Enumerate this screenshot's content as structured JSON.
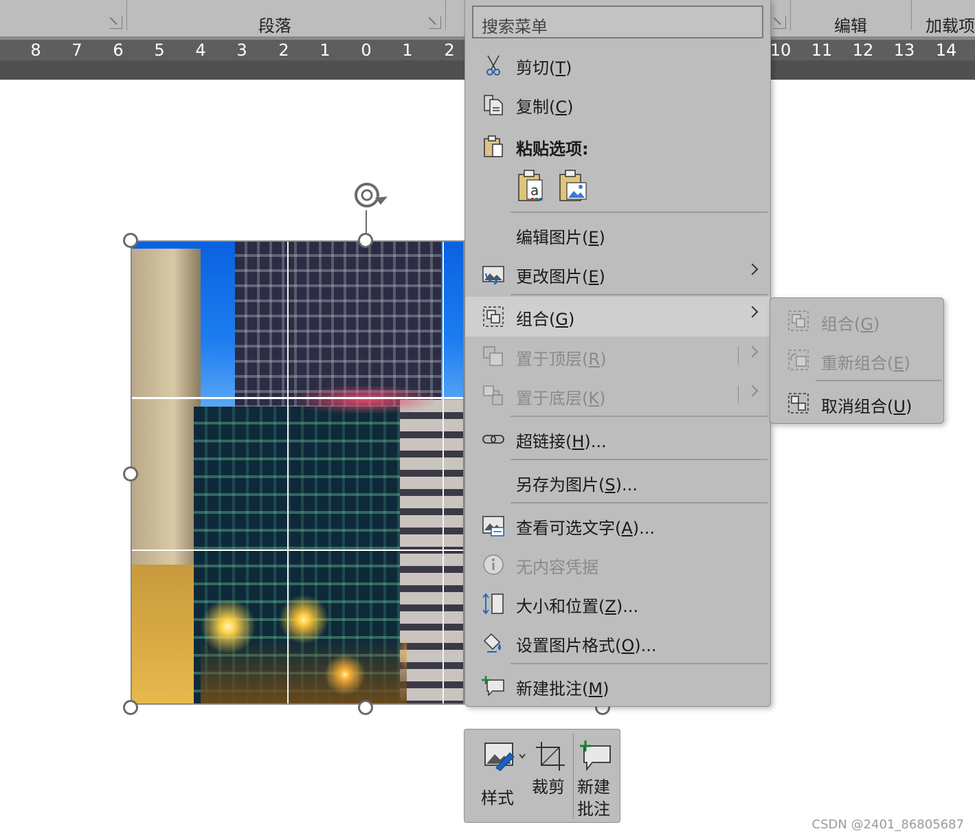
{
  "ribbon": {
    "groups": [
      "段落",
      "编辑",
      "加载项"
    ]
  },
  "ruler": {
    "left_numbers": [
      "8",
      "7",
      "6",
      "5",
      "4",
      "3",
      "2",
      "1",
      "0",
      "1",
      "2"
    ],
    "right_numbers": [
      "10",
      "11",
      "12",
      "13",
      "14"
    ]
  },
  "context_menu": {
    "search_placeholder": "搜索菜单",
    "items": {
      "cut": {
        "label": "剪切(",
        "key": "T",
        "tail": ")",
        "icon": "scissors-icon"
      },
      "copy": {
        "label": "复制(",
        "key": "C",
        "tail": ")",
        "icon": "copy-icon"
      },
      "paste_header": {
        "label": "粘贴选项:",
        "icon": "clipboard-icon"
      },
      "edit_picture": {
        "label": "编辑图片(",
        "key": "E",
        "tail": ")"
      },
      "change_picture": {
        "label": "更改图片(",
        "key": "E",
        "tail": ")",
        "icon": "change-picture-icon"
      },
      "group": {
        "label": "组合(",
        "key": "G",
        "tail": ")",
        "icon": "group-icon"
      },
      "bring_front": {
        "label": "置于顶层(",
        "key": "R",
        "tail": ")",
        "icon": "bring-to-front-icon"
      },
      "send_back": {
        "label": "置于底层(",
        "key": "K",
        "tail": ")",
        "icon": "send-to-back-icon"
      },
      "hyperlink": {
        "label": "超链接(",
        "key": "H",
        "tail": ")...",
        "icon": "link-icon"
      },
      "save_as_picture": {
        "label": "另存为图片(",
        "key": "S",
        "tail": ")..."
      },
      "alt_text": {
        "label": "查看可选文字(",
        "key": "A",
        "tail": ")...",
        "icon": "alt-text-icon"
      },
      "no_credentials": {
        "label": "无内容凭据",
        "icon": "info-icon"
      },
      "size_position": {
        "label": "大小和位置(",
        "key": "Z",
        "tail": ")...",
        "icon": "size-position-icon"
      },
      "format_picture": {
        "label": "设置图片格式(",
        "key": "O",
        "tail": ")...",
        "icon": "format-picture-icon"
      },
      "new_comment": {
        "label": "新建批注(",
        "key": "M",
        "tail": ")",
        "icon": "new-comment-icon"
      }
    }
  },
  "submenu": {
    "group": {
      "label": "组合(",
      "key": "G",
      "tail": ")"
    },
    "regroup": {
      "label": "重新组合(",
      "key": "E",
      "tail": ")"
    },
    "ungroup": {
      "label": "取消组合(",
      "key": "U",
      "tail": ")"
    }
  },
  "mini_toolbar": {
    "style": "样式",
    "crop": "裁剪",
    "new_comment_line1": "新建",
    "new_comment_line2": "批注"
  },
  "watermark": "CSDN @2401_86805687",
  "colors": {
    "menu_bg": "#bdbdbd",
    "highlight": "#cfcfcf",
    "ruler_bg": "#5e5e5e",
    "comment_plus": "#1e7d32"
  }
}
